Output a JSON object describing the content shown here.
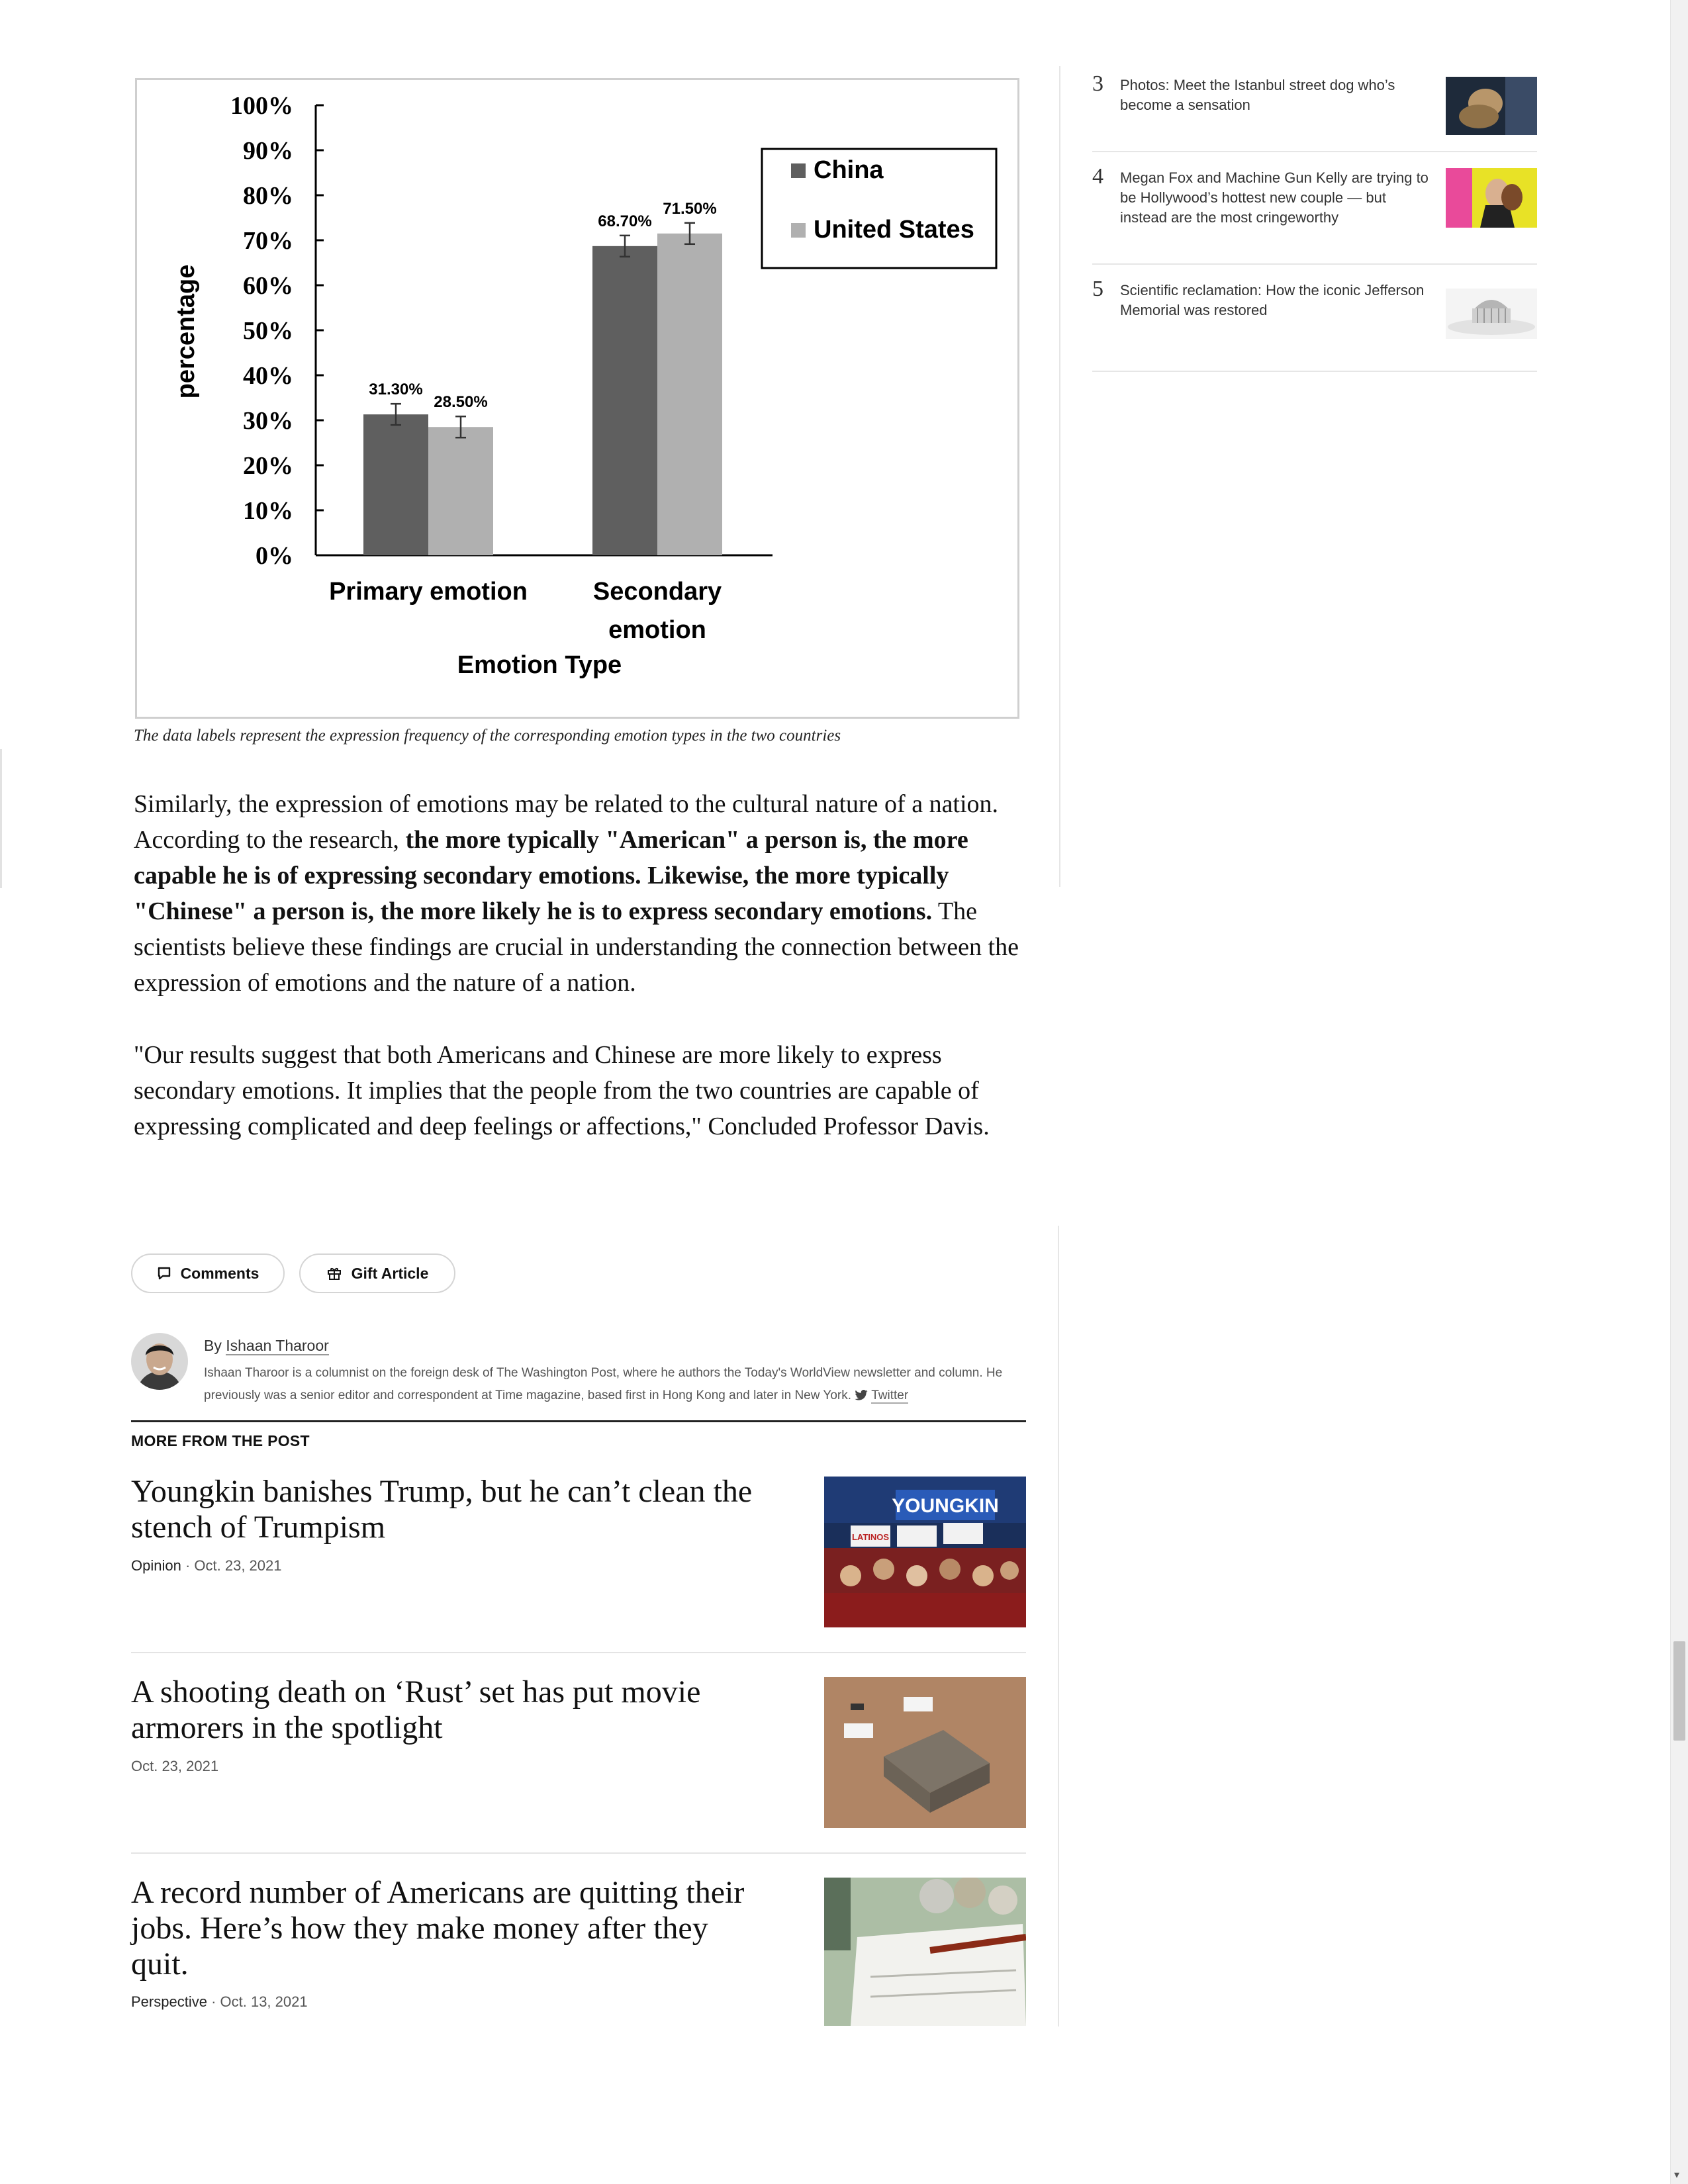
{
  "chart": {
    "caption": "The data labels represent the expression frequency of the corresponding emotion types in the two countries"
  },
  "chart_data": {
    "type": "bar",
    "categories": [
      "Primary emotion",
      "Secondary emotion"
    ],
    "series": [
      {
        "name": "China",
        "values": [
          31.3,
          68.7
        ],
        "labels": [
          "31.30%",
          "68.70%"
        ],
        "color": "#5f5f5f"
      },
      {
        "name": "United States",
        "values": [
          28.5,
          71.5
        ],
        "labels": [
          "28.50%",
          "71.50%"
        ],
        "color": "#b0b0b0"
      }
    ],
    "error_bars": true,
    "title": "",
    "xlabel": "Emotion Type",
    "ylabel": "percentage",
    "ylim": [
      0,
      100
    ],
    "yticks": [
      "0%",
      "10%",
      "20%",
      "30%",
      "40%",
      "50%",
      "60%",
      "70%",
      "80%",
      "90%",
      "100%"
    ],
    "legend_position": "top-right",
    "grid": false
  },
  "article": {
    "p1_a": "Similarly, the expression of emotions may be related to the cultural nature of a nation. According to the research, ",
    "p1_bold": "the more typically \"American\" a person is, the more capable he is of expressing secondary emotions. Likewise, the more typically \"Chinese\" a person is, the more likely he is to express secondary emotions.",
    "p1_b": " The scientists believe these findings are crucial in understanding the connection between the expression of emotions and the nature of a nation.",
    "p2": "\"Our results suggest that both Americans and Chinese are more likely to express secondary emotions. It implies that the people from the two countries are capable of expressing complicated and deep feelings or affections,\" Concluded Professor Davis."
  },
  "actions": {
    "comments_label": "Comments",
    "gift_label": "Gift Article"
  },
  "author": {
    "by": "By",
    "name": "Ishaan Tharoor",
    "bio": "Ishaan Tharoor is a columnist on the foreign desk of The Washington Post, where he authors the Today's WorldView newsletter and column. He previously was a senior editor and correspondent at Time magazine, based first in Hong Kong and later in New York.",
    "twitter_label": "Twitter"
  },
  "more_from_post": {
    "heading": "MORE FROM THE POST",
    "stories": [
      {
        "title": "Youngkin banishes Trump, but he can’t clean the stench of Trumpism",
        "kicker": "Opinion",
        "sep": " · ",
        "date": "Oct. 23, 2021"
      },
      {
        "title": "A shooting death on ‘Rust’ set has put movie armorers in the spotlight",
        "kicker": "",
        "sep": "",
        "date": "Oct. 23, 2021"
      },
      {
        "title": "A record number of Americans are quitting their jobs. Here’s how they make money after they quit.",
        "kicker": "Perspective",
        "sep": " · ",
        "date": "Oct. 13, 2021"
      }
    ],
    "thumb_sign_text": "YOUNGKIN",
    "thumb_small_sign": "LATINOS"
  },
  "rail": {
    "items": [
      {
        "num": "3",
        "text": "Photos: Meet the Istanbul street dog who’s become a sensation"
      },
      {
        "num": "4",
        "text": "Megan Fox and Machine Gun Kelly are trying to be Hollywood’s hottest new couple — but instead are the most cringeworthy"
      },
      {
        "num": "5",
        "text": "Scientific reclamation: How the iconic Jefferson Memorial was restored"
      }
    ]
  },
  "icons": [
    "comment-icon",
    "gift-icon",
    "twitter-icon",
    "scroll-down-arrow-icon"
  ]
}
